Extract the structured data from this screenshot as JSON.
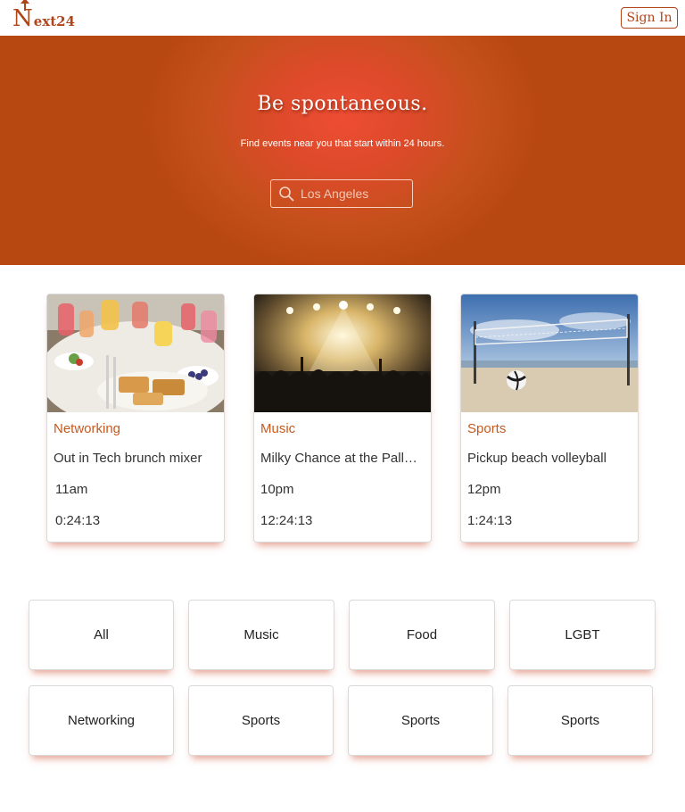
{
  "header": {
    "logo_big": "N",
    "logo_small": "ext24",
    "signin_label": "Sign In"
  },
  "hero": {
    "title": "Be spontaneous.",
    "subtitle": "Find events near you that start within 24 hours.",
    "search_placeholder": "Los Angeles",
    "search_value": ""
  },
  "events": [
    {
      "category": "Networking",
      "title": "Out in Tech brunch mixer",
      "time": "11am",
      "countdown": "0:24:13",
      "image": "brunch-table-photo"
    },
    {
      "category": "Music",
      "title": "Milky Chance at the Palladium",
      "time": "10pm",
      "countdown": "12:24:13",
      "image": "concert-stage-photo"
    },
    {
      "category": "Sports",
      "title": "Pickup beach volleyball",
      "time": "12pm",
      "countdown": "1:24:13",
      "image": "beach-volleyball-photo"
    }
  ],
  "categories": [
    {
      "label": "All"
    },
    {
      "label": "Music"
    },
    {
      "label": "Food"
    },
    {
      "label": "LGBT"
    },
    {
      "label": "Networking"
    },
    {
      "label": "Sports"
    },
    {
      "label": "Sports"
    },
    {
      "label": "Sports"
    }
  ],
  "colors": {
    "brand": "#b1451a",
    "hero_center": "#ee4d33",
    "hero_edge": "#b84812",
    "category_text": "#c75a1e"
  }
}
